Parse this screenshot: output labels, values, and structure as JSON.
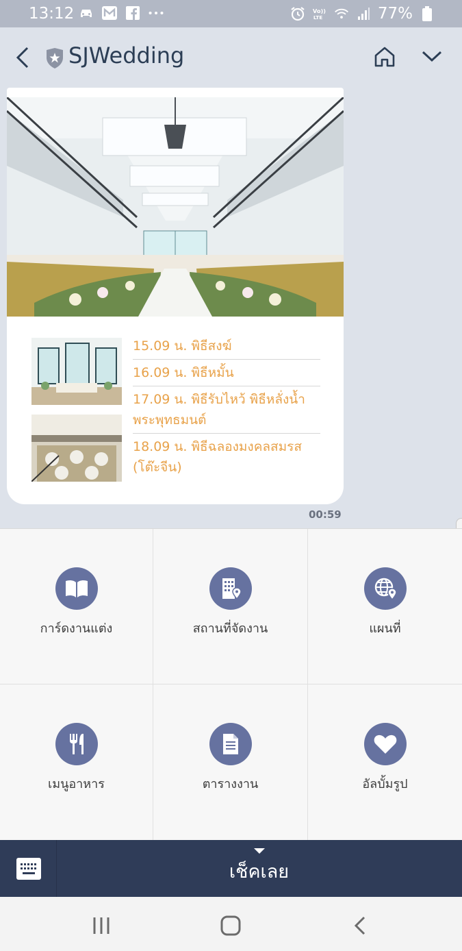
{
  "status_bar": {
    "time": "13:12",
    "left_icons": [
      "car-icon",
      "mail-icon",
      "facebook-icon",
      "more-dots-icon"
    ],
    "right_icons": [
      "alarm-icon",
      "volte-icon",
      "wifi-icon",
      "signal-icon",
      "battery-icon"
    ],
    "battery": "77%"
  },
  "header": {
    "title": "SJWedding",
    "accent_color": "#2c3e55"
  },
  "message": {
    "schedule": [
      "15.09 น. พิธีสงฆ์",
      "16.09 น. พิธีหมั้น",
      "17.09 น. พิธีรับไหว้ พิธีหลั่งน้ำพระพุทธมนต์",
      "18.09 น. พิธีฉลองมงคลสมรส (โต๊ะจีน)"
    ],
    "time": "00:59",
    "item_color": "#e8a24a"
  },
  "menu": {
    "items": [
      {
        "label": "การ์ดงานแต่ง",
        "icon": "book-icon"
      },
      {
        "label": "สถานที่จัดงาน",
        "icon": "building-location-icon"
      },
      {
        "label": "แผนที่",
        "icon": "globe-location-icon"
      },
      {
        "label": "เมนูอาหาร",
        "icon": "fork-knife-icon"
      },
      {
        "label": "ตารางงาน",
        "icon": "document-icon"
      },
      {
        "label": "อัลบั้มรูป",
        "icon": "heart-icon"
      }
    ],
    "icon_bg": "#6672a0"
  },
  "bottom_bar": {
    "label": "เช็คเลย",
    "bg_color": "#2f3c58"
  }
}
